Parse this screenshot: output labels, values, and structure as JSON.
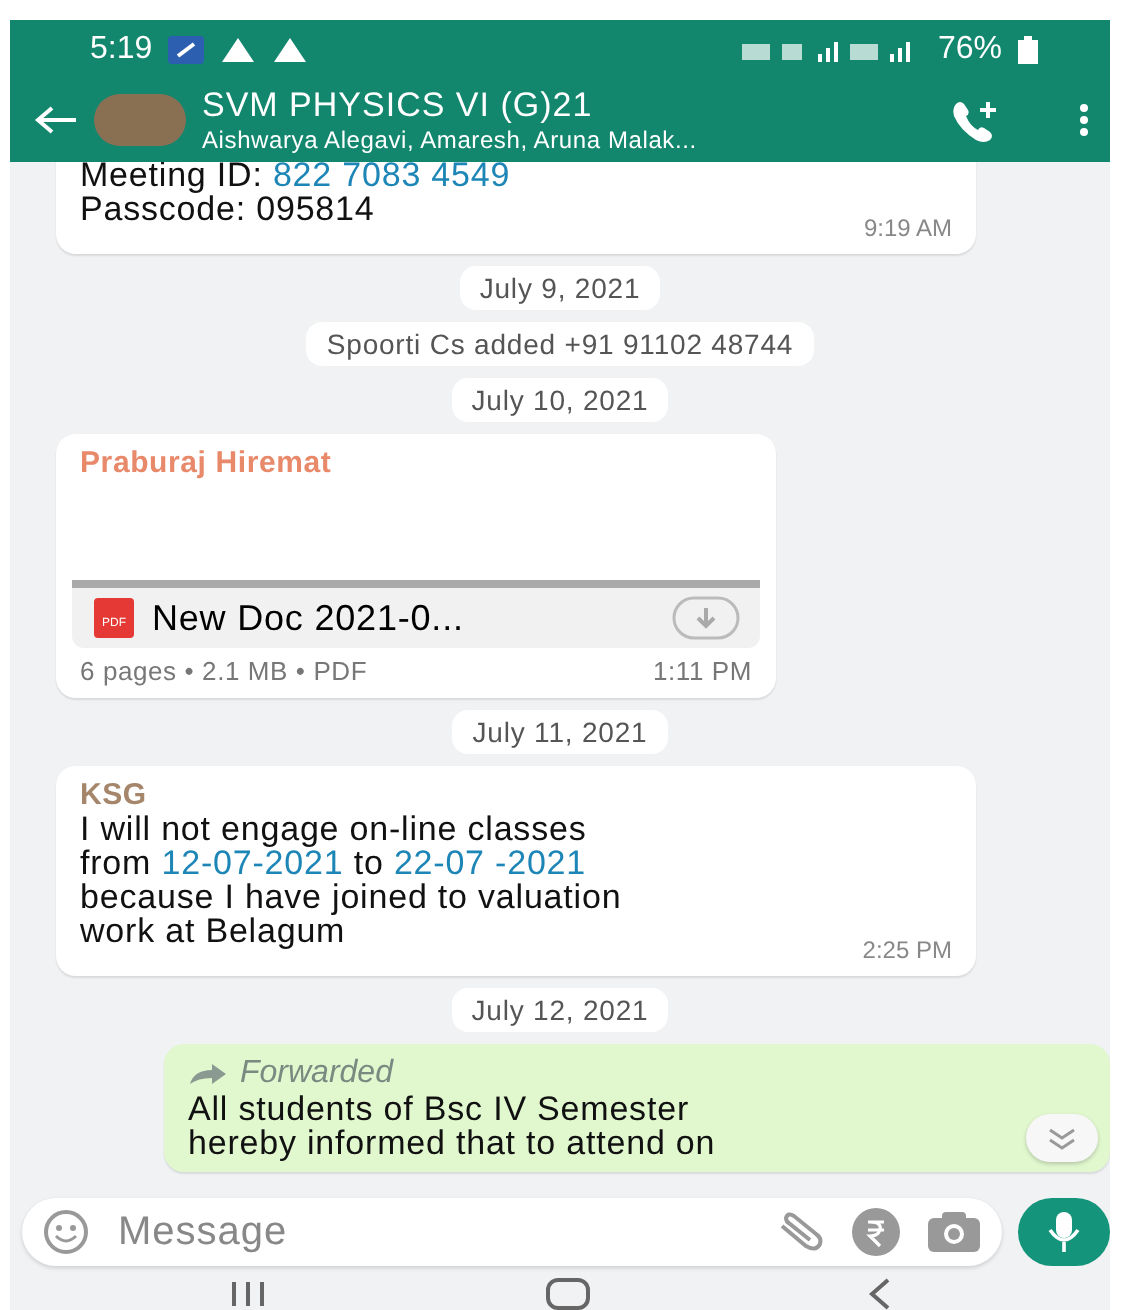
{
  "status_bar": {
    "time": "5:19",
    "battery": "76%"
  },
  "header": {
    "title": "SVM PHYSICS VI (G)21",
    "subtitle": "Aishwarya Alegavi, Amaresh, Aruna Malak..."
  },
  "messages": [
    {
      "kind": "text",
      "outgoing": false,
      "clipped_top": true,
      "lines": [
        [
          {
            "text": "Meeting ID: "
          },
          {
            "text": "822 7083 4549",
            "link": true
          }
        ],
        [
          {
            "text": "Passcode: 095814"
          }
        ]
      ],
      "time": "9:19 AM"
    },
    {
      "kind": "date",
      "text": "July 9, 2021"
    },
    {
      "kind": "system",
      "text": "Spoorti Cs added +91 91102 48744"
    },
    {
      "kind": "date",
      "text": "July 10, 2021"
    },
    {
      "kind": "document",
      "sender": "Praburaj Hiremat",
      "color": "#e8896a",
      "file_type": "PDF",
      "file_name": "New Doc 2021-0...",
      "meta": "6 pages • 2.1 MB • PDF",
      "time": "1:11 PM"
    },
    {
      "kind": "date",
      "text": "July 11, 2021"
    },
    {
      "kind": "text",
      "outgoing": false,
      "sender": "KSG",
      "color": "#a5866b",
      "lines": [
        [
          {
            "text": "I will not engage on-line classes"
          }
        ],
        [
          {
            "text": "from "
          },
          {
            "text": "12-07-2021",
            "link": true
          },
          {
            "text": " to "
          },
          {
            "text": "22-07 -2021",
            "link": true
          }
        ],
        [
          {
            "text": "because I have joined to valuation"
          }
        ],
        [
          {
            "text": "work at Belagum"
          }
        ]
      ],
      "time": "2:25 PM"
    },
    {
      "kind": "date",
      "text": "July 12, 2021"
    },
    {
      "kind": "text",
      "outgoing": true,
      "forwarded": "Forwarded",
      "lines": [
        [
          {
            "text": "All students of Bsc IV Semester"
          }
        ],
        [
          {
            "text": "hereby informed that to attend on"
          }
        ]
      ]
    }
  ],
  "composer": {
    "placeholder": "Message"
  }
}
